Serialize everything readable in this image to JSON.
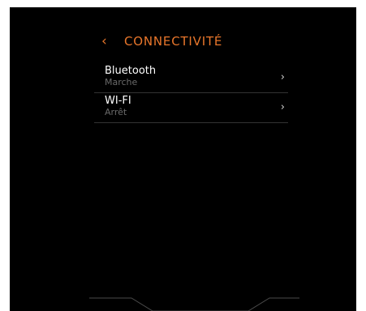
{
  "header": {
    "back_icon": "‹",
    "title": "CONNECTIVITÉ"
  },
  "items": [
    {
      "label": "Bluetooth",
      "value": "Marche",
      "chevron": "›"
    },
    {
      "label": "WI-FI",
      "value": "Arrêt",
      "chevron": "›"
    }
  ],
  "colors": {
    "accent": "#e8762b",
    "background": "#000000",
    "text": "#ffffff",
    "secondary_text": "#6a6a6a",
    "divider": "#333333"
  },
  "icons": [
    "chevron-left-icon",
    "chevron-right-icon"
  ]
}
